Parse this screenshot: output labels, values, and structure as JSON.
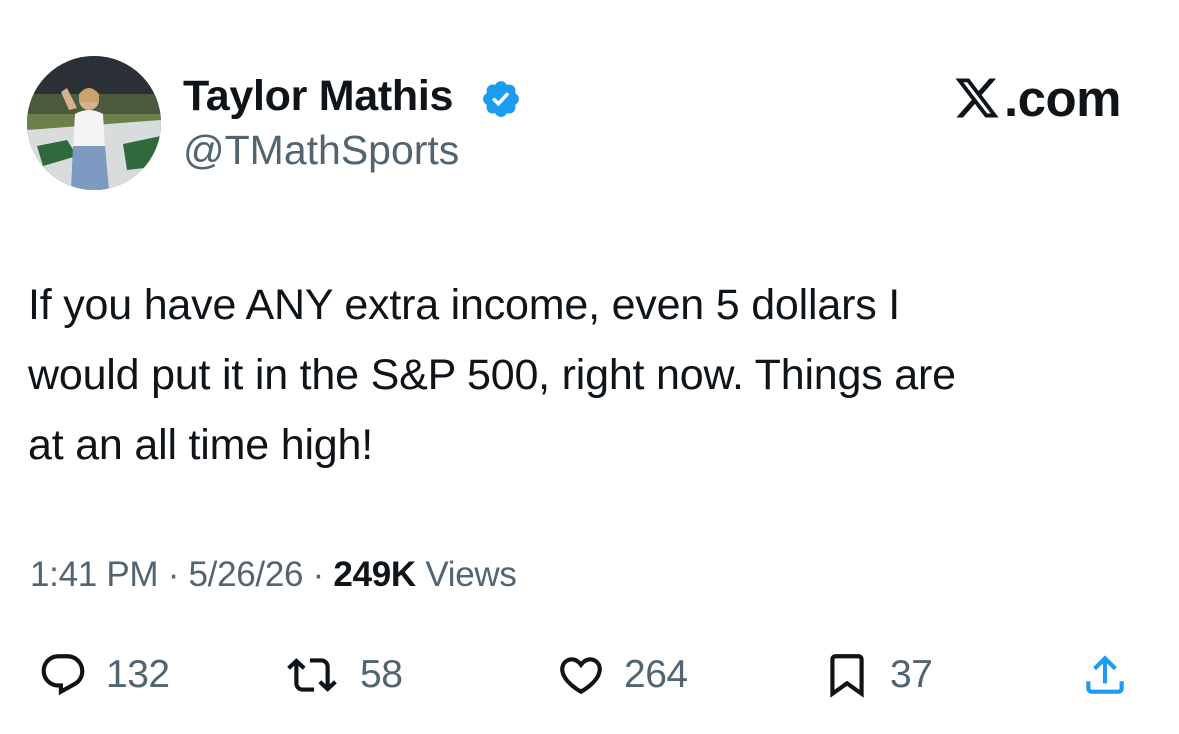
{
  "user": {
    "display_name": "Taylor Mathis",
    "handle": "@TMathSports",
    "verified": true
  },
  "brand": {
    "suffix": ".com"
  },
  "tweet": {
    "text": "If you have ANY extra income, even 5 dollars I\nwould put it in the S&P 500, right now. Things are\nat an all time high!"
  },
  "meta": {
    "time": "1:41 PM",
    "date": "5/26/26",
    "separator": "·",
    "views_count": "249K",
    "views_label": "Views"
  },
  "actions": {
    "replies": "132",
    "reposts": "58",
    "likes": "264",
    "bookmarks": "37"
  },
  "colors": {
    "text": "#0f1419",
    "secondary": "#536471",
    "verified": "#1d9bf0"
  },
  "icons": {
    "reply": "reply-icon",
    "repost": "repost-icon",
    "like": "heart-icon",
    "bookmark": "bookmark-icon",
    "share": "share-icon",
    "verified": "verified-badge-icon",
    "brand": "x-logo-icon"
  }
}
